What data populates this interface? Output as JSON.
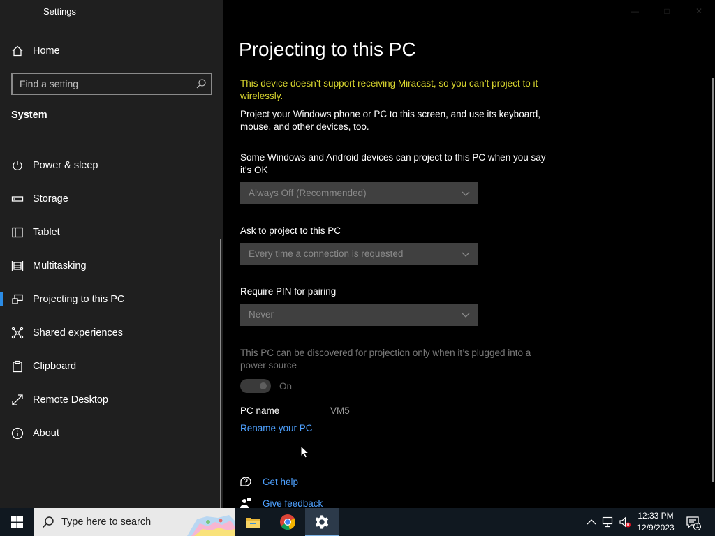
{
  "window": {
    "title": "Settings"
  },
  "sidebar": {
    "home_label": "Home",
    "search_placeholder": "Find a setting",
    "section_title": "System",
    "items": [
      {
        "label": "Power & sleep",
        "icon": "power-icon"
      },
      {
        "label": "Storage",
        "icon": "storage-icon"
      },
      {
        "label": "Tablet",
        "icon": "tablet-icon"
      },
      {
        "label": "Multitasking",
        "icon": "multitasking-icon"
      },
      {
        "label": "Projecting to this PC",
        "icon": "projecting-icon",
        "selected": true
      },
      {
        "label": "Shared experiences",
        "icon": "shared-experiences-icon"
      },
      {
        "label": "Clipboard",
        "icon": "clipboard-icon"
      },
      {
        "label": "Remote Desktop",
        "icon": "remote-desktop-icon"
      },
      {
        "label": "About",
        "icon": "info-icon"
      }
    ]
  },
  "main": {
    "title": "Projecting to this PC",
    "warning": "This device doesn’t support receiving Miracast, so you can’t project to it wirelessly.",
    "description": "Project your Windows phone or PC to this screen, and use its keyboard, mouse, and other devices, too.",
    "setting1": {
      "label": "Some Windows and Android devices can project to this PC when you say it’s OK",
      "value": "Always Off (Recommended)"
    },
    "setting2": {
      "label": "Ask to project to this PC",
      "value": "Every time a connection is requested"
    },
    "setting3": {
      "label": "Require PIN for pairing",
      "value": "Never"
    },
    "power_note": "This PC can be discovered for projection only when it’s plugged into a power source",
    "toggle_label": "On",
    "pc_name_label": "PC name",
    "pc_name_value": "VM5",
    "rename_link": "Rename your PC",
    "get_help": "Get help",
    "give_feedback": "Give feedback"
  },
  "taskbar": {
    "search_placeholder": "Type here to search",
    "time": "12:33 PM",
    "date": "12/9/2023",
    "notification_count": "1",
    "apps": [
      "file-explorer-icon",
      "chrome-icon",
      "settings-icon"
    ]
  },
  "colors": {
    "accent": "#2b8ce6",
    "warning": "#d9d62f",
    "link": "#4ea1ff",
    "sidebar_bg": "#1f1f1f",
    "main_bg": "#000000",
    "taskbar_bg": "#101820"
  }
}
